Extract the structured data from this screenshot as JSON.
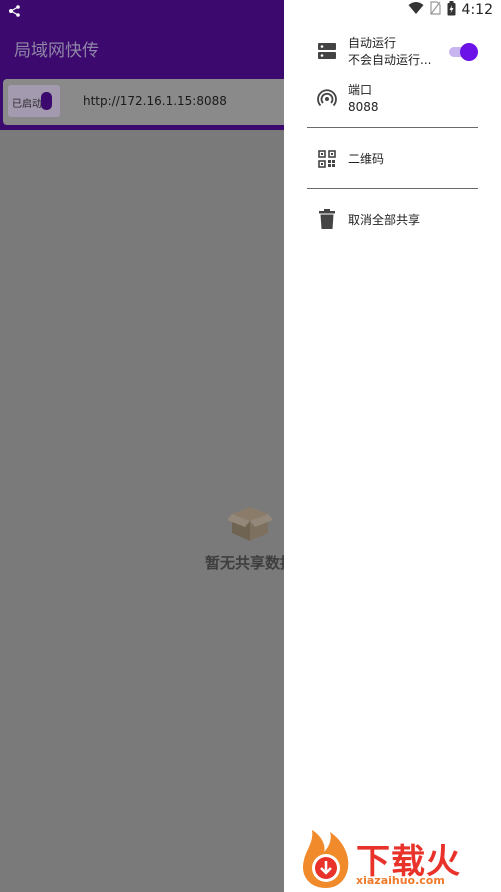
{
  "status_bar": {
    "time": "4:12"
  },
  "app": {
    "title": "局域网快传",
    "toggle_label": "已启动",
    "url": "http://172.16.1.15:8088",
    "empty_text": "暂无共享数据"
  },
  "drawer": {
    "auto_run": {
      "title": "自动运行",
      "subtitle": "不会自动运行...",
      "enabled": true
    },
    "port": {
      "title": "端口",
      "value": "8088"
    },
    "qr": {
      "label": "二维码"
    },
    "cancel_all": {
      "label": "取消全部共享"
    }
  },
  "watermark": {
    "title": "下载火",
    "domain": "xiazaihuo.com"
  },
  "colors": {
    "primary": "#3c0a6e",
    "accent": "#6a12e8",
    "watermark": "#e8322a"
  }
}
